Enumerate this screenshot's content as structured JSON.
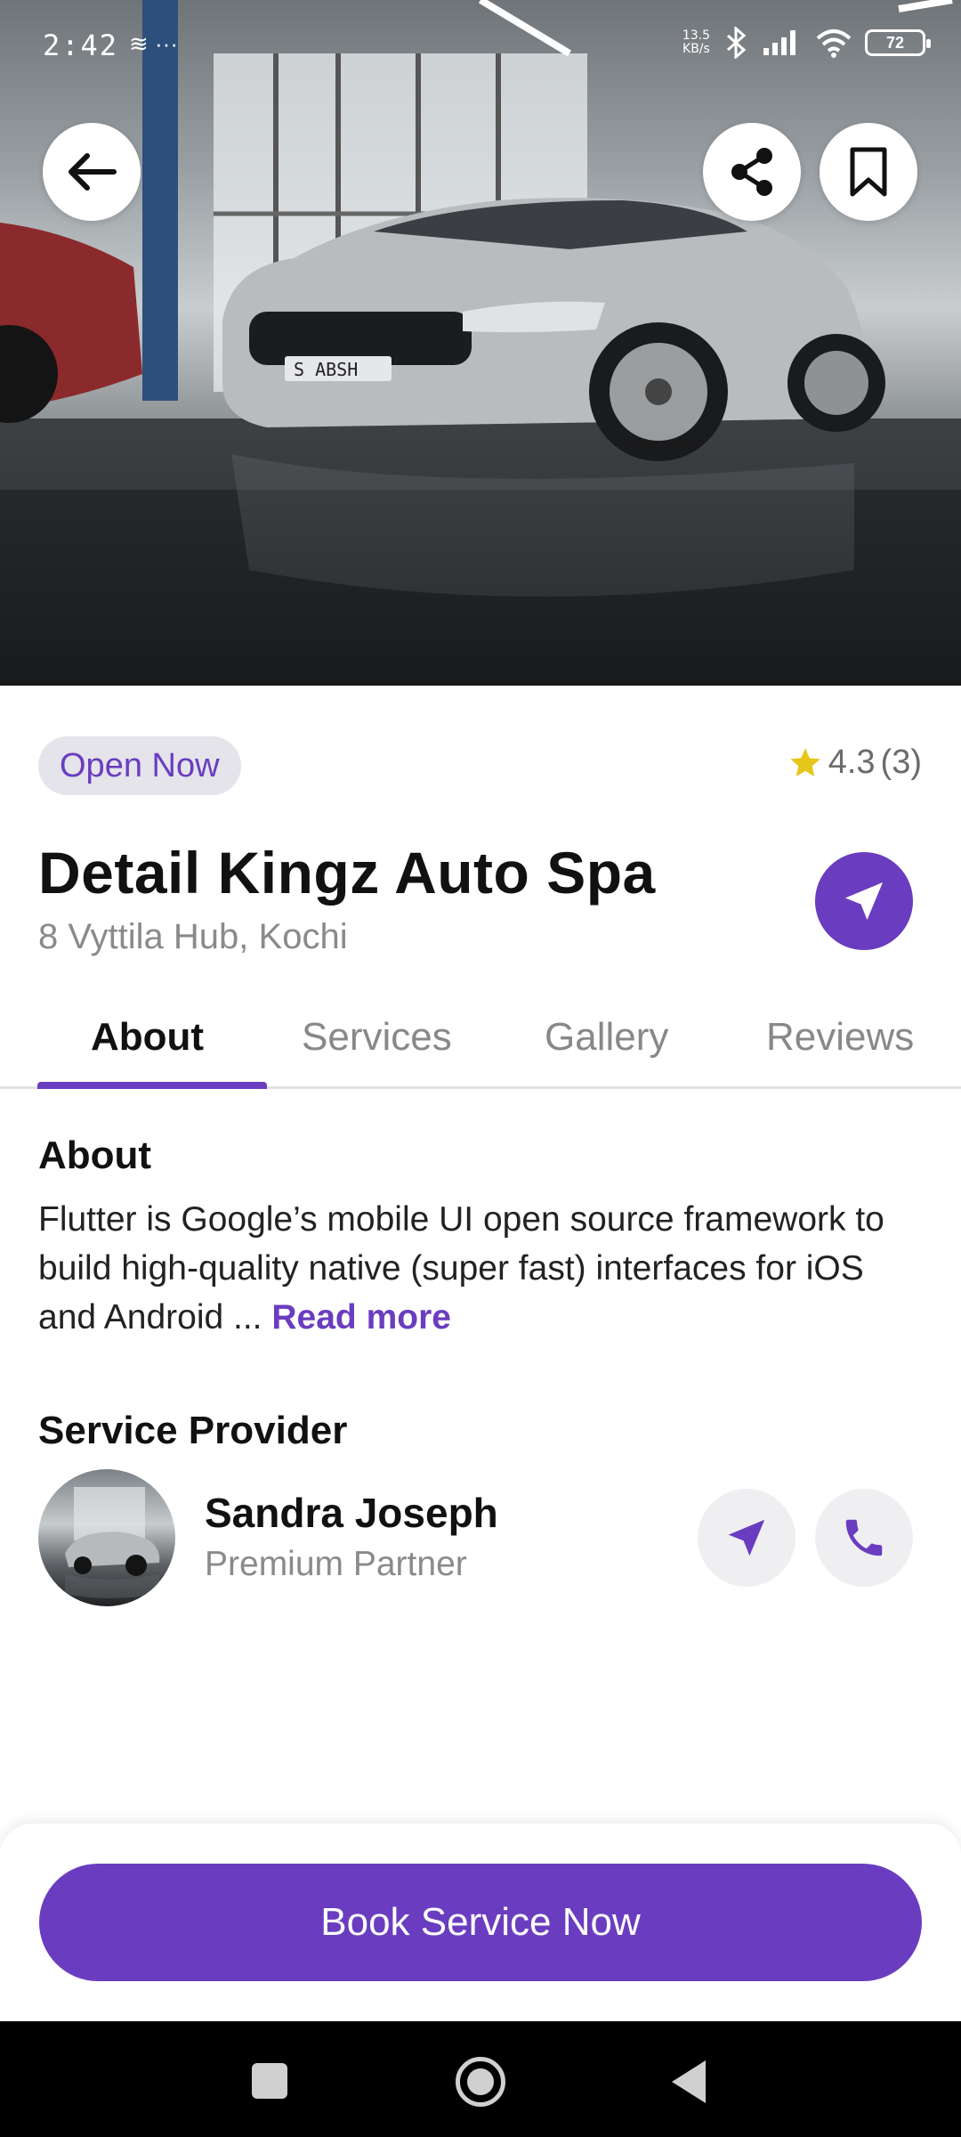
{
  "status_bar": {
    "time": "2:42",
    "left_icons": "≋ ···",
    "net_speed_value": "13.5",
    "net_speed_unit": "KB/s",
    "battery": "72"
  },
  "hero": {
    "image_desc_icon": "car-photo",
    "plate": "S ABSH"
  },
  "shop": {
    "status_badge": "Open Now",
    "rating": "4.3",
    "rating_count": "(3)",
    "name": "Detail Kingz Auto Spa",
    "address": "8 Vyttila Hub, Kochi"
  },
  "tabs": [
    {
      "label": "About",
      "active": true
    },
    {
      "label": "Services",
      "active": false
    },
    {
      "label": "Gallery",
      "active": false
    },
    {
      "label": "Reviews",
      "active": false
    }
  ],
  "about": {
    "heading": "About",
    "text": "Flutter is Google’s mobile UI open source framework to build high-quality native (super fast) interfaces for iOS and Android ...",
    "read_more": "Read more"
  },
  "provider": {
    "heading": "Service Provider",
    "name": "Sandra Joseph",
    "role": "Premium Partner"
  },
  "cta": {
    "book_label": "Book Service Now"
  },
  "colors": {
    "accent": "#6a3dc0",
    "star": "#e6c619"
  }
}
